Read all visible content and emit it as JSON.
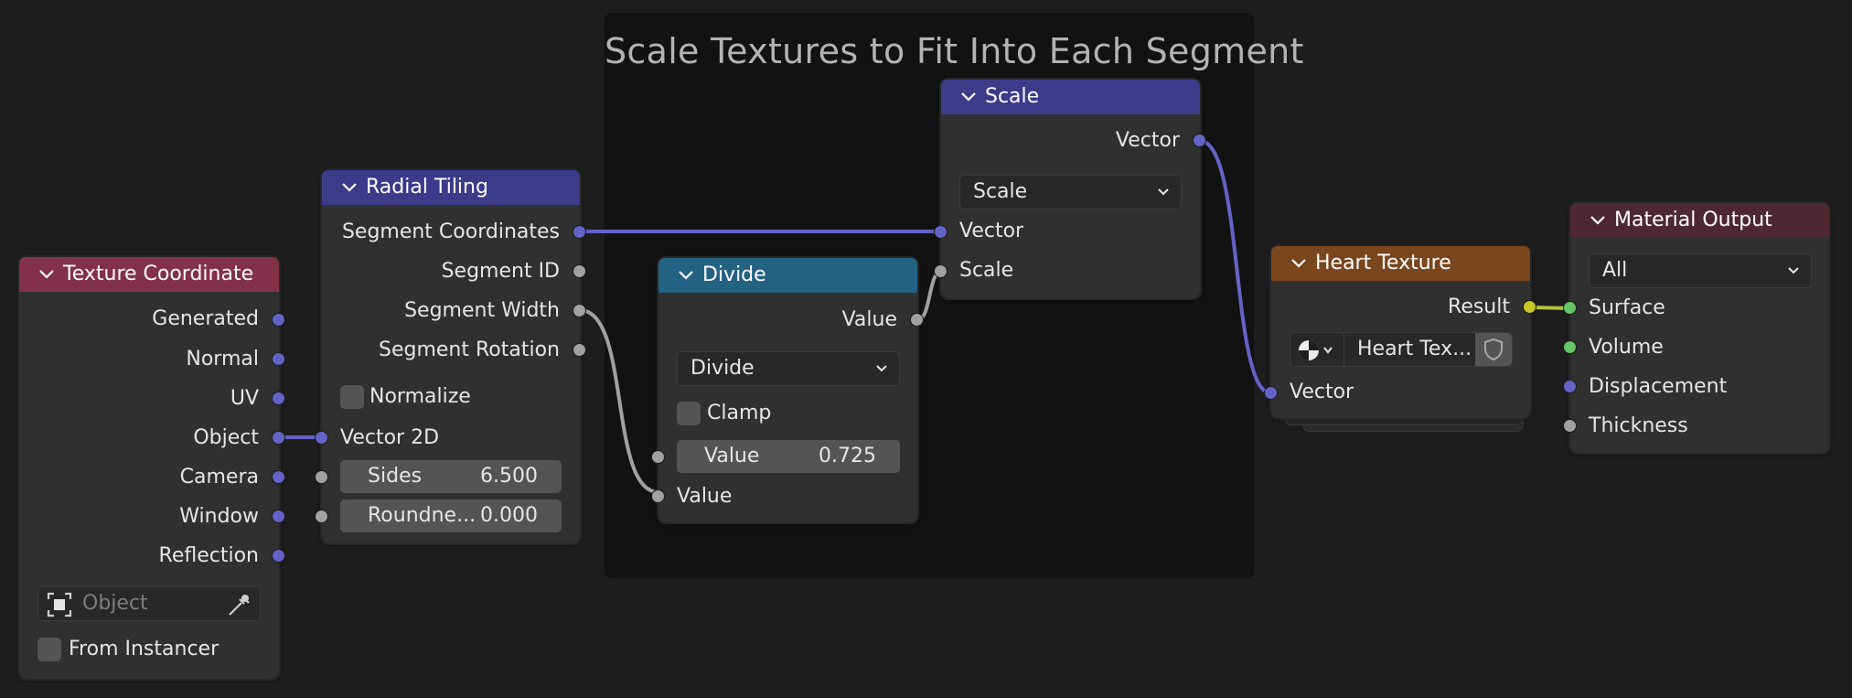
{
  "frame": {
    "title": "Scale Textures to Fit Into Each Segment"
  },
  "texture_coordinate": {
    "title": "Texture Coordinate",
    "outputs": [
      "Generated",
      "Normal",
      "UV",
      "Object",
      "Camera",
      "Window",
      "Reflection"
    ],
    "object_placeholder": "Object",
    "from_instancer_label": "From Instancer"
  },
  "radial_tiling": {
    "title": "Radial Tiling",
    "outputs": [
      "Segment Coordinates",
      "Segment ID",
      "Segment Width",
      "Segment Rotation"
    ],
    "normalize_label": "Normalize",
    "vector_label": "Vector 2D",
    "sides_label": "Sides",
    "sides_value": "6.500",
    "roundness_label": "Roundne...",
    "roundness_value": "0.000"
  },
  "divide": {
    "title": "Divide",
    "output": "Value",
    "operation": "Divide",
    "clamp_label": "Clamp",
    "value_label": "Value",
    "value_value": "0.725",
    "input_label": "Value"
  },
  "scale": {
    "title": "Scale",
    "output": "Vector",
    "operation": "Scale",
    "input_vector": "Vector",
    "input_scale": "Scale"
  },
  "heart_texture": {
    "title": "Heart Texture",
    "output": "Result",
    "datablock": "Heart Tex...",
    "input": "Vector"
  },
  "material_output": {
    "title": "Material Output",
    "target": "All",
    "inputs": [
      "Surface",
      "Volume",
      "Displacement",
      "Thickness"
    ]
  },
  "colors": {
    "input_header": "#83314a",
    "group_header": "#3b3b8a",
    "converter_header": "#246283",
    "texture_header": "#79461d",
    "output_header": "#4d2832",
    "vector_socket": "#6363c7",
    "float_socket": "#a1a1a1",
    "shader_socket": "#63c763",
    "color_socket": "#c7c729"
  }
}
